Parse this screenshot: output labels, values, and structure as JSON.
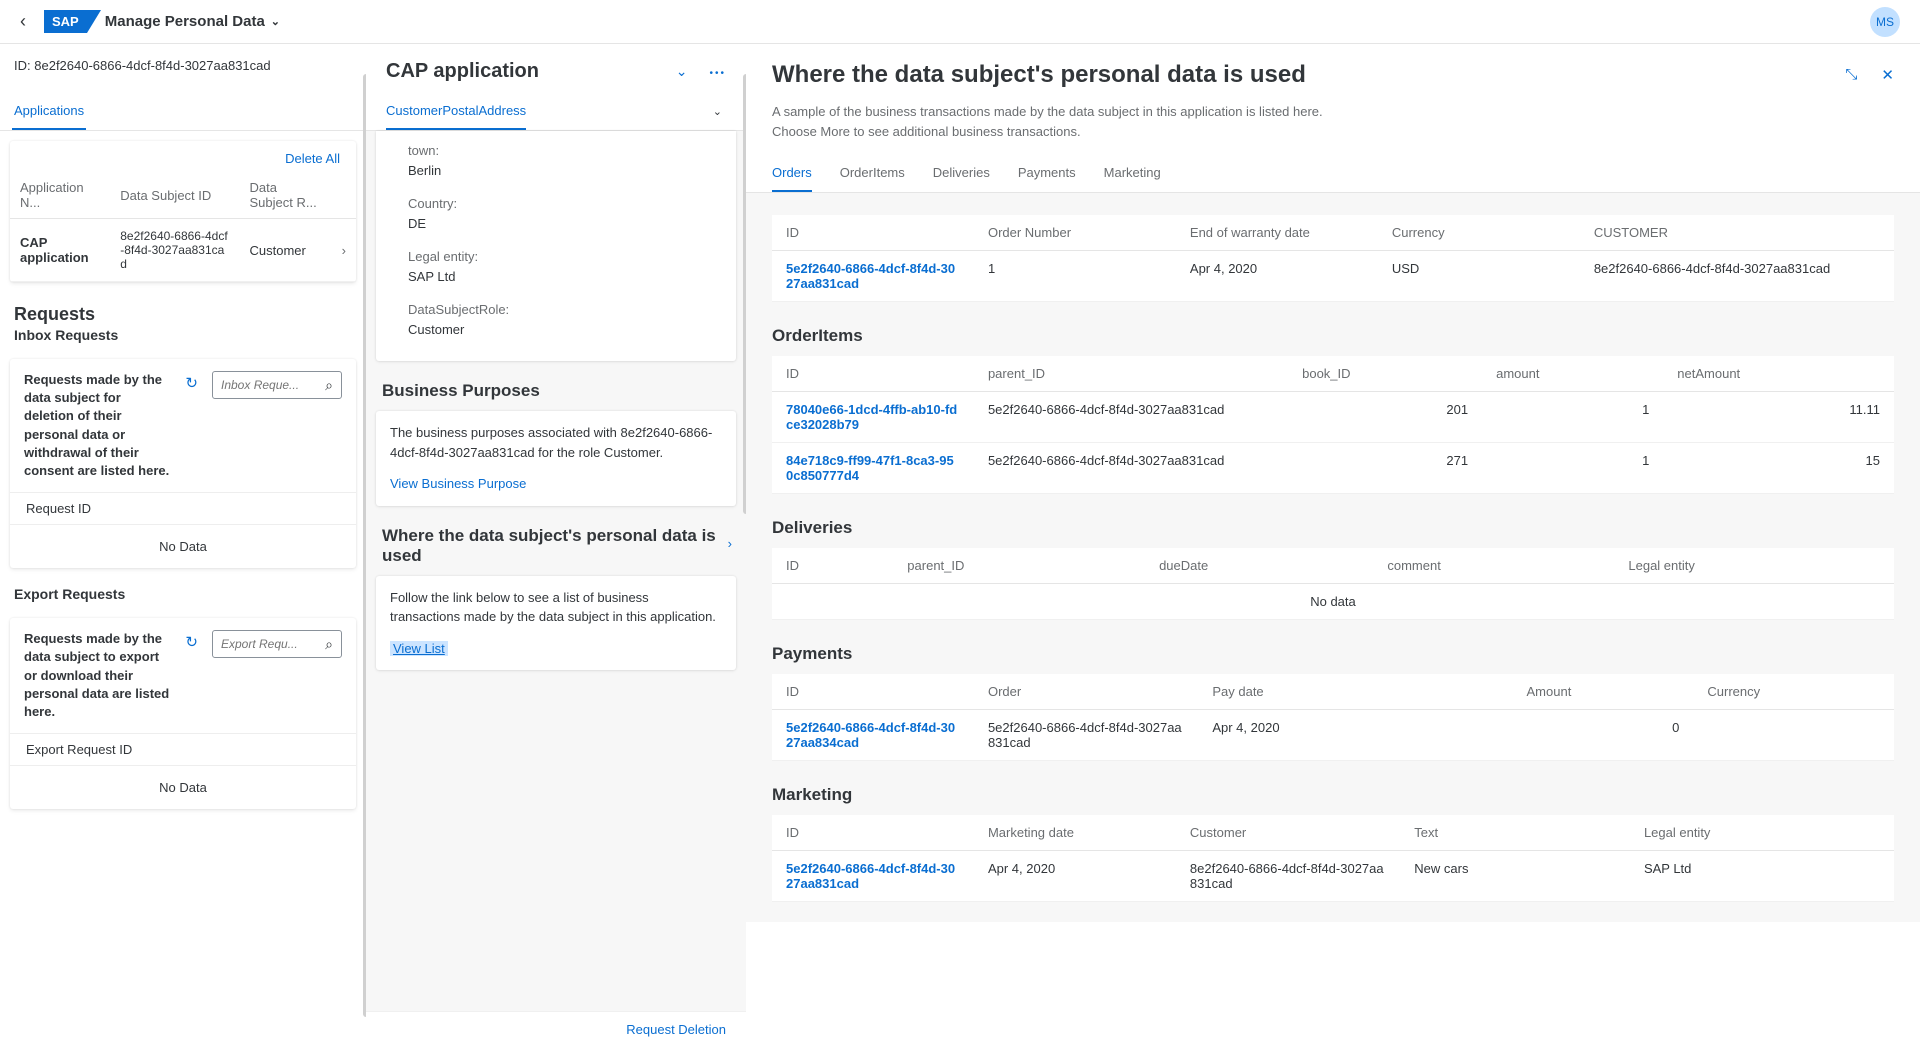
{
  "header": {
    "app_title": "Manage Personal Data",
    "avatar_initials": "MS"
  },
  "col1": {
    "id_label": "ID:",
    "id_value": "8e2f2640-6866-4dcf-8f4d-3027aa831cad",
    "tab_applications": "Applications",
    "delete_all": "Delete All",
    "table": {
      "col_app": "Application N...",
      "col_dsid": "Data Subject ID",
      "col_role": "Data Subject R...",
      "row": {
        "app": "CAP application",
        "dsid": "8e2f2640-6866-4dcf-8f4d-3027aa831cad",
        "role": "Customer"
      }
    },
    "requests_title": "Requests",
    "inbox_title": "Inbox Requests",
    "inbox_text": "Requests made by the data subject for deletion of their personal data or withdrawal of their consent are listed here.",
    "inbox_placeholder": "Inbox Reque...",
    "inbox_head": "Request ID",
    "nodata": "No Data",
    "export_title": "Export Requests",
    "export_text": "Requests made by the data subject to export or download their personal data are listed here.",
    "export_placeholder": "Export Requ...",
    "export_head": "Export Request ID"
  },
  "col2": {
    "title": "CAP application",
    "subtab": "CustomerPostalAddress",
    "fields": {
      "town_label": "town:",
      "town_value": "Berlin",
      "country_label": "Country:",
      "country_value": "DE",
      "legal_label": "Legal entity:",
      "legal_value": "SAP Ltd",
      "role_label": "DataSubjectRole:",
      "role_value": "Customer"
    },
    "bp_title": "Business Purposes",
    "bp_text": "The business purposes associated with 8e2f2640-6866-4dcf-8f4d-3027aa831cad for the role Customer.",
    "bp_link": "View Business Purpose",
    "where_title": "Where the data subject's personal data is used",
    "where_text": "Follow the link below to see a list of business transactions made by the data subject in this application.",
    "view_list": "View List",
    "footer_btn": "Request Deletion"
  },
  "col3": {
    "title": "Where the data subject's personal data is used",
    "desc": "A sample of the business transactions made by the data subject in this application is listed here. Choose More to see additional business transactions.",
    "tabs": {
      "orders": "Orders",
      "orderitems": "OrderItems",
      "deliveries": "Deliveries",
      "payments": "Payments",
      "marketing": "Marketing"
    },
    "orders": {
      "h_id": "ID",
      "h_num": "Order Number",
      "h_eow": "End of warranty date",
      "h_cur": "Currency",
      "h_cust": "CUSTOMER",
      "r1_id": "5e2f2640-6866-4dcf-8f4d-3027aa831cad",
      "r1_num": "1",
      "r1_eow": "Apr 4, 2020",
      "r1_cur": "USD",
      "r1_cust": "8e2f2640-6866-4dcf-8f4d-3027aa831cad"
    },
    "orderitems_title": "OrderItems",
    "orderitems": {
      "h_id": "ID",
      "h_parent": "parent_ID",
      "h_book": "book_ID",
      "h_amount": "amount",
      "h_net": "netAmount",
      "r1_id": "78040e66-1dcd-4ffb-ab10-fdce32028b79",
      "r1_parent": "5e2f2640-6866-4dcf-8f4d-3027aa831cad",
      "r1_book": "201",
      "r1_amount": "1",
      "r1_net": "11.11",
      "r2_id": "84e718c9-ff99-47f1-8ca3-950c850777d4",
      "r2_parent": "5e2f2640-6866-4dcf-8f4d-3027aa831cad",
      "r2_book": "271",
      "r2_amount": "1",
      "r2_net": "15"
    },
    "deliveries_title": "Deliveries",
    "deliveries": {
      "h_id": "ID",
      "h_parent": "parent_ID",
      "h_due": "dueDate",
      "h_comment": "comment",
      "h_legal": "Legal entity",
      "nodata": "No data"
    },
    "payments_title": "Payments",
    "payments": {
      "h_id": "ID",
      "h_order": "Order",
      "h_pay": "Pay date",
      "h_amount": "Amount",
      "h_cur": "Currency",
      "r1_id": "5e2f2640-6866-4dcf-8f4d-3027aa834cad",
      "r1_order": "5e2f2640-6866-4dcf-8f4d-3027aa831cad",
      "r1_pay": "Apr 4, 2020",
      "r1_amount": "0",
      "r1_cur": ""
    },
    "marketing_title": "Marketing",
    "marketing": {
      "h_id": "ID",
      "h_date": "Marketing date",
      "h_cust": "Customer",
      "h_text": "Text",
      "h_legal": "Legal entity",
      "r1_id": "5e2f2640-6866-4dcf-8f4d-3027aa831cad",
      "r1_date": "Apr 4, 2020",
      "r1_cust": "8e2f2640-6866-4dcf-8f4d-3027aa831cad",
      "r1_text": "New cars",
      "r1_legal": "SAP Ltd"
    }
  }
}
